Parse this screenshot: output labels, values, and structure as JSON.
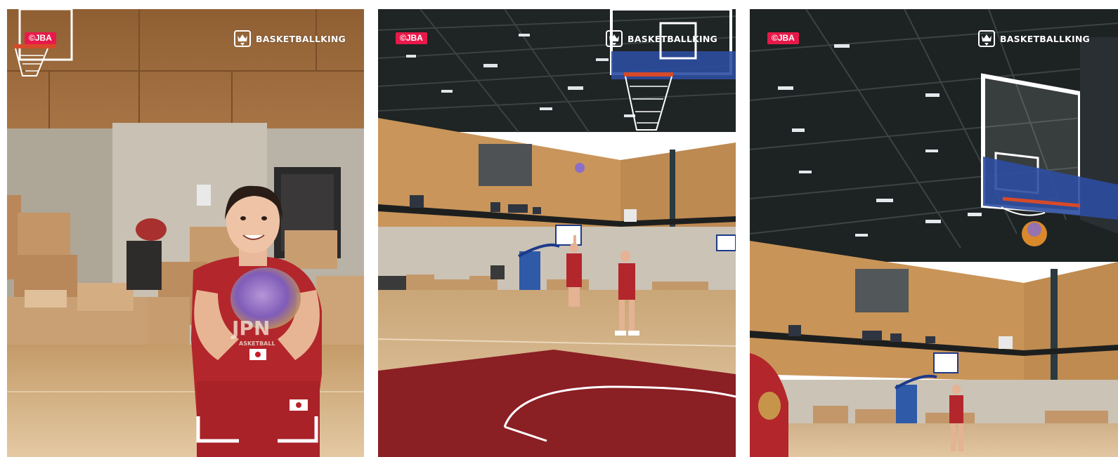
{
  "watermark": {
    "jba_label": "©JBA",
    "brand_label": "BASKETBALLKING",
    "badge_color": "#e8194a",
    "brand_icon": "crown-shield-icon"
  },
  "panels": [
    {
      "name": "player-closeup-catching-ball"
    },
    {
      "name": "gym-wide-shot-two-players"
    },
    {
      "name": "gym-wide-shot-ball-at-hoop"
    }
  ],
  "jersey": {
    "chest_text": "JPN",
    "sub_text": "ASKETBALL",
    "color": "#b3262c"
  },
  "colors": {
    "court_wood": "#d9b98d",
    "wall_panels": "#b88651",
    "ceiling": "#1f2424",
    "paint": "#8a1f24",
    "ball": "#8a6fc8"
  }
}
